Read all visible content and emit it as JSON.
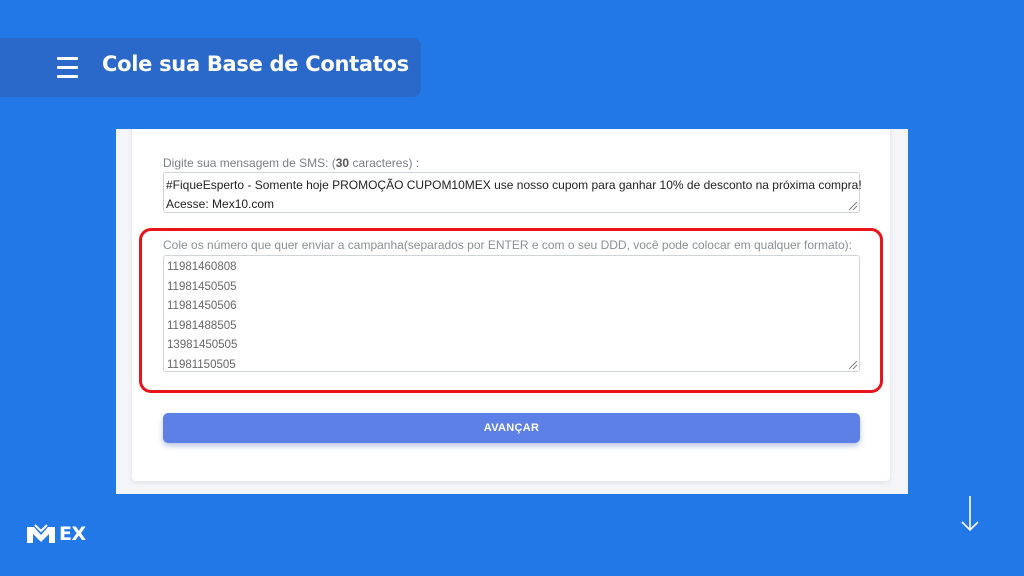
{
  "header": {
    "title": "Cole sua Base de Contatos",
    "menu_icon": "hamburger-menu-icon"
  },
  "sms": {
    "label_prefix": "Digite sua mensagem de SMS: (",
    "char_count": "30",
    "label_suffix": " caracteres) :",
    "message_line1": "#FiqueEsperto - Somente hoje PROMOÇÃO CUPOM10MEX  use nosso cupom para ganhar 10% de desconto na próxima compra!",
    "message_line2": "Acesse: Mex10.com"
  },
  "numbers": {
    "label": "Cole os número que quer enviar a campanha(separados por ENTER e com o seu DDD, você pode colocar em qualquer formato):",
    "list": [
      "11981460808",
      "11981450505",
      "11981450506",
      "11981488505",
      "13981450505",
      "11981150505"
    ]
  },
  "button": {
    "label": "AVANÇAR"
  },
  "brand": {
    "logo_text": "EX",
    "logo_icon": "mex-m-logo-icon"
  },
  "colors": {
    "background": "#2378e8",
    "title_bar": "#2a69c9",
    "highlight": "#e8131b",
    "button": "#5c80e6"
  },
  "icons": {
    "scroll_hint": "arrow-down-icon"
  }
}
